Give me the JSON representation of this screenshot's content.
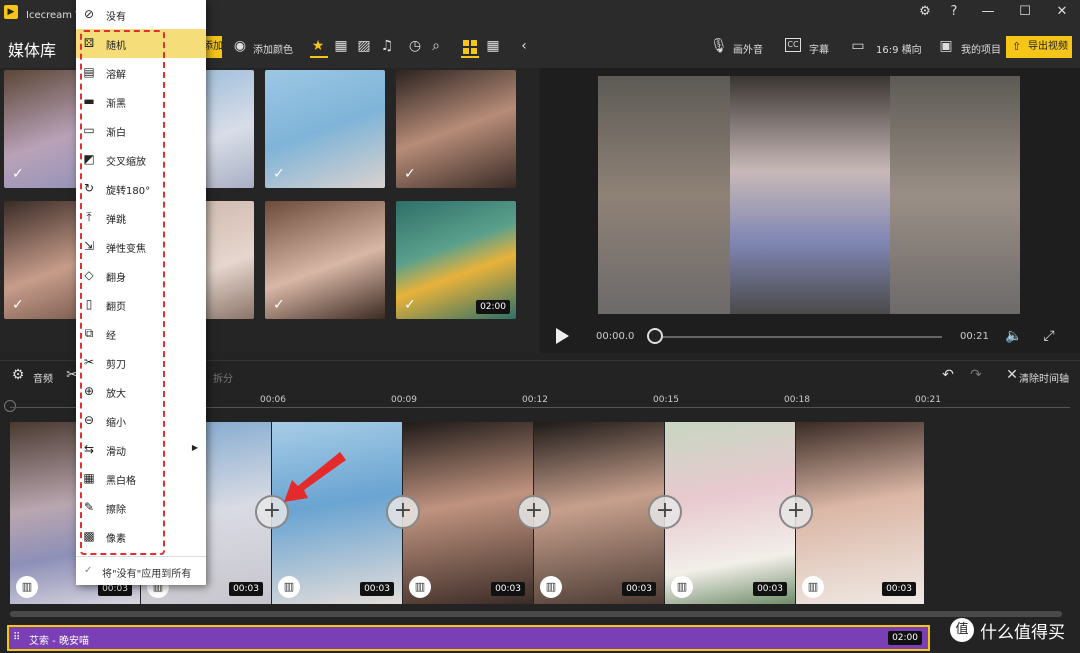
{
  "window": {
    "title": "Icecream Video Editor - 项目1"
  },
  "toolbar": {
    "library": "媒体库",
    "add_file": "添加文件",
    "add_color": "添加颜色",
    "voiceover": "画外音",
    "subtitles": "字幕",
    "aspect": "16:9 横向",
    "my_projects": "我的项目",
    "export": "导出视频"
  },
  "media": [
    {
      "dur": ""
    },
    {
      "dur": ""
    },
    {
      "dur": ""
    },
    {
      "dur": ""
    },
    {
      "dur": ""
    },
    {
      "dur": ""
    },
    {
      "dur": ""
    },
    {
      "dur": "02:00"
    }
  ],
  "player": {
    "current": "00:00.0",
    "total": "00:21"
  },
  "timeline_bar": {
    "audio": "音频",
    "split": "拆分",
    "clear": "清除时间轴"
  },
  "ruler": [
    "00:06",
    "00:09",
    "00:12",
    "00:15",
    "00:18",
    "00:21"
  ],
  "clips": [
    "00:03",
    "00:03",
    "00:03",
    "00:03",
    "00:03",
    "00:03",
    "00:03"
  ],
  "audio_track": {
    "label": "艾索 - 晚安喵",
    "dur": "02:00"
  },
  "watermark": "什么值得买",
  "menu": {
    "items": [
      {
        "label": "没有",
        "icon": "⊘"
      },
      {
        "label": "随机",
        "icon": "⚄"
      },
      {
        "label": "溶解",
        "icon": "▤"
      },
      {
        "label": "渐黑",
        "icon": "▬"
      },
      {
        "label": "渐白",
        "icon": "▭"
      },
      {
        "label": "交叉缩放",
        "icon": "◩"
      },
      {
        "label": "旋转180°",
        "icon": "↻"
      },
      {
        "label": "弹跳",
        "icon": "⤒"
      },
      {
        "label": "弹性变焦",
        "icon": "⇲"
      },
      {
        "label": "翻身",
        "icon": "◇"
      },
      {
        "label": "翻页",
        "icon": "▯"
      },
      {
        "label": "经",
        "icon": "⧉"
      },
      {
        "label": "剪刀",
        "icon": "✂"
      },
      {
        "label": "放大",
        "icon": "⊕"
      },
      {
        "label": "缩小",
        "icon": "⊖"
      },
      {
        "label": "滑动",
        "icon": "⇆"
      },
      {
        "label": "黑白格",
        "icon": "▦"
      },
      {
        "label": "擦除",
        "icon": "✎"
      },
      {
        "label": "像素",
        "icon": "▩"
      }
    ],
    "apply_all": "将\"没有\"应用到所有"
  }
}
